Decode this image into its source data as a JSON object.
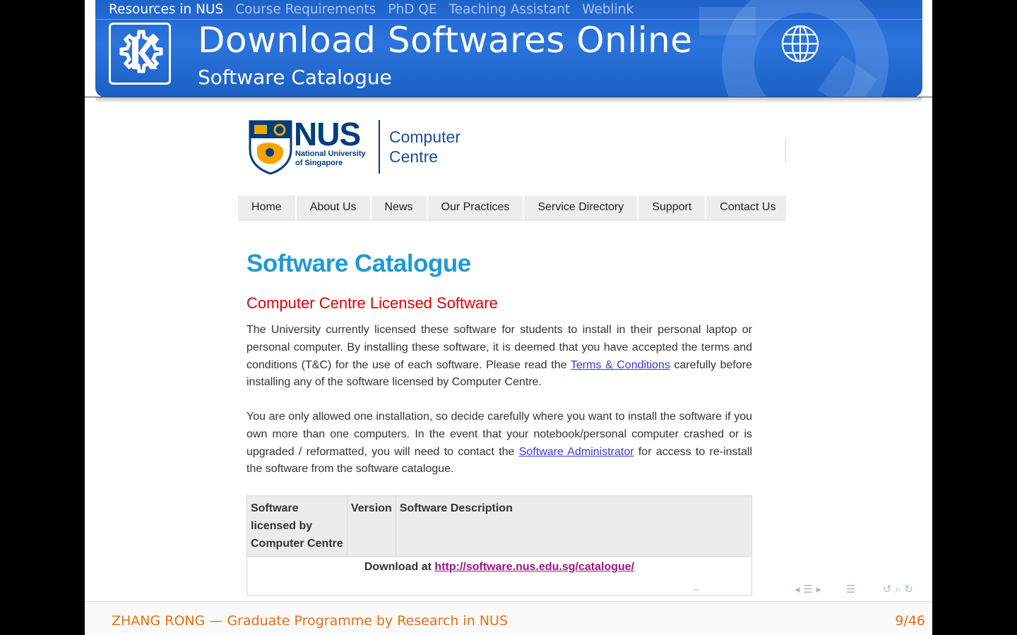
{
  "header": {
    "nav_items": [
      "Resources in NUS",
      "Course Requirements",
      "PhD QE",
      "Teaching Assistant",
      "Weblink"
    ],
    "active_index": 0,
    "title": "Download Softwares Online",
    "subtitle": "Software Catalogue"
  },
  "webpage": {
    "logo": {
      "nus": "NUS",
      "nus_line1": "National University",
      "nus_line2": "of Singapore",
      "cc_line1": "Computer",
      "cc_line2": "Centre"
    },
    "menu": [
      "Home",
      "About Us",
      "News",
      "Our Practices",
      "Service Directory",
      "Support",
      "Contact Us"
    ],
    "heading": "Software Catalogue",
    "subheading": "Computer Centre Licensed Software",
    "para1": {
      "before": "The University currently licensed these software for students to install in their personal laptop or personal computer. By installing these software, it is deemed that you have accepted the terms and conditions (T&C) for the use of each software. Please read the ",
      "link": "Terms & Conditions",
      "after": " carefully before installing any of the software licensed by Computer Centre."
    },
    "para2": {
      "before": "You are only allowed one installation, so decide carefully where you want to install the software if you own more than one computers. In the event that your notebook/personal computer crashed or is upgraded / reformatted, you will need to contact the ",
      "link": "Software Administrator",
      "after": " for access to re-install the software from the software catalogue."
    },
    "table": {
      "headers": [
        "Software licensed by Computer Centre",
        "Version",
        "Software Description"
      ],
      "download_label": "Download at ",
      "download_link": "http://software.nus.edu.sg/catalogue/"
    }
  },
  "footer": {
    "left": "ZHANG RONG — Graduate Programme by Research in NUS",
    "page": "9/46"
  },
  "colors": {
    "banner": "#2b74dc",
    "footer_text": "#e86e10",
    "heading": "#1e9ad6",
    "subheading": "#e00000"
  }
}
